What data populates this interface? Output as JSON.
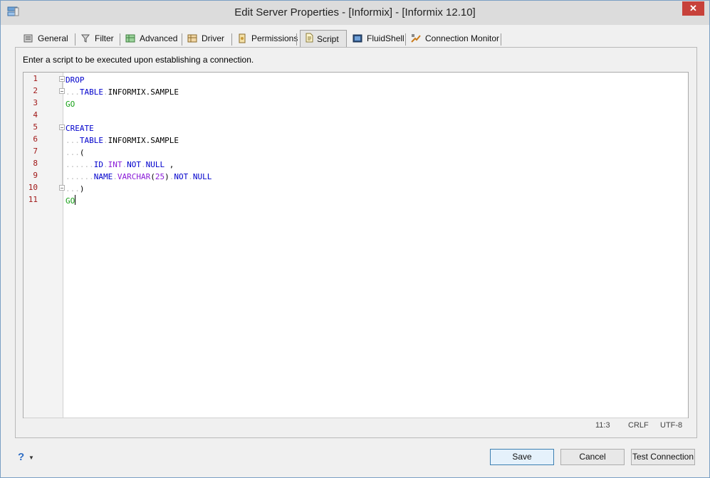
{
  "window": {
    "title": "Edit Server Properties - [Informix] - [Informix 12.10]",
    "close_label": "✕"
  },
  "tabs": [
    {
      "label": "General",
      "icon": "general-icon"
    },
    {
      "label": "Filter",
      "icon": "filter-icon"
    },
    {
      "label": "Advanced",
      "icon": "advanced-icon"
    },
    {
      "label": "Driver",
      "icon": "driver-icon"
    },
    {
      "label": "Permissions",
      "icon": "permissions-icon"
    },
    {
      "label": "Script",
      "icon": "script-icon",
      "active": true
    },
    {
      "label": "FluidShell",
      "icon": "fluidshell-icon"
    },
    {
      "label": "Connection Monitor",
      "icon": "connection-monitor-icon"
    }
  ],
  "script_panel": {
    "instruction": "Enter a script to be executed upon establishing a connection.",
    "line_numbers": [
      "1",
      "2",
      "3",
      "4",
      "5",
      "6",
      "7",
      "8",
      "9",
      "10",
      "11"
    ]
  },
  "code": {
    "l1": {
      "kw": "DROP"
    },
    "l2": {
      "dots": "...",
      "kw": "TABLE",
      "rest": "INFORMIX.SAMPLE"
    },
    "l3": {
      "go": "GO"
    },
    "l5": {
      "kw": "CREATE"
    },
    "l6": {
      "dots": "...",
      "kw": "TABLE",
      "rest": "INFORMIX.SAMPLE"
    },
    "l7": {
      "dots": "...",
      "rest": "("
    },
    "l8": {
      "dots": "......",
      "col": "ID",
      "type": "INT",
      "c1": "NOT",
      "c2": "NULL",
      "tail": " ,"
    },
    "l9": {
      "dots": "......",
      "col": "NAME",
      "type": "VARCHAR",
      "paren_open": "(",
      "num": "25",
      "paren_close": ")",
      "c1": "NOT",
      "c2": "NULL"
    },
    "l10": {
      "dots": "...",
      "rest": ")"
    },
    "l11": {
      "go": "GO"
    }
  },
  "status": {
    "position": "11:3",
    "line_ending": "CRLF",
    "encoding": "UTF-8"
  },
  "footer": {
    "help_symbol": "?",
    "save": "Save",
    "cancel": "Cancel",
    "test_connection": "Test Connection"
  },
  "colors": {
    "keyword": "#0000cc",
    "type": "#8a1bd8",
    "go": "#16a016",
    "line_number": "#a01818",
    "close": "#c7413a"
  }
}
